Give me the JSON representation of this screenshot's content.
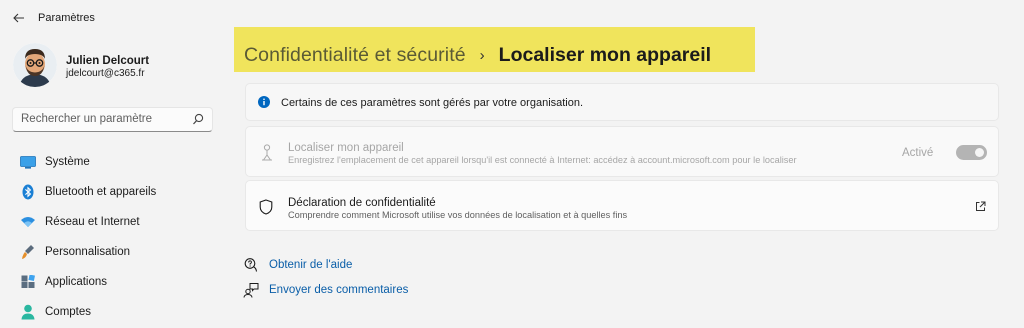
{
  "window": {
    "title": "Paramètres"
  },
  "user": {
    "name": "Julien Delcourt",
    "email": "jdelcourt@c365.fr"
  },
  "search": {
    "placeholder": "Rechercher un paramètre"
  },
  "sidebar": {
    "items": [
      {
        "label": "Système",
        "icon": "system-icon"
      },
      {
        "label": "Bluetooth et appareils",
        "icon": "bluetooth-icon"
      },
      {
        "label": "Réseau et Internet",
        "icon": "wifi-icon"
      },
      {
        "label": "Personnalisation",
        "icon": "brush-icon"
      },
      {
        "label": "Applications",
        "icon": "apps-icon"
      },
      {
        "label": "Comptes",
        "icon": "person-icon"
      }
    ]
  },
  "header": {
    "parent": "Confidentialité et sécurité",
    "separator": "›",
    "current": "Localiser mon appareil",
    "highlight_color": "#f0e45c"
  },
  "info_banner": {
    "text": "Certains de ces paramètres sont gérés par votre organisation."
  },
  "locate_device": {
    "title": "Localiser mon appareil",
    "description": "Enregistrez l'emplacement de cet appareil lorsqu'il est connecté à Internet: accédez à account.microsoft.com pour le localiser",
    "toggle_label": "Activé",
    "toggle_on": true,
    "disabled": true
  },
  "privacy_statement": {
    "title": "Déclaration de confidentialité",
    "description": "Comprendre comment Microsoft utilise vos données de localisation et à quelles fins"
  },
  "links": {
    "help": "Obtenir de l'aide",
    "feedback": "Envoyer des commentaires"
  },
  "colors": {
    "accent": "#0067c0",
    "link": "#0a5ea8"
  }
}
